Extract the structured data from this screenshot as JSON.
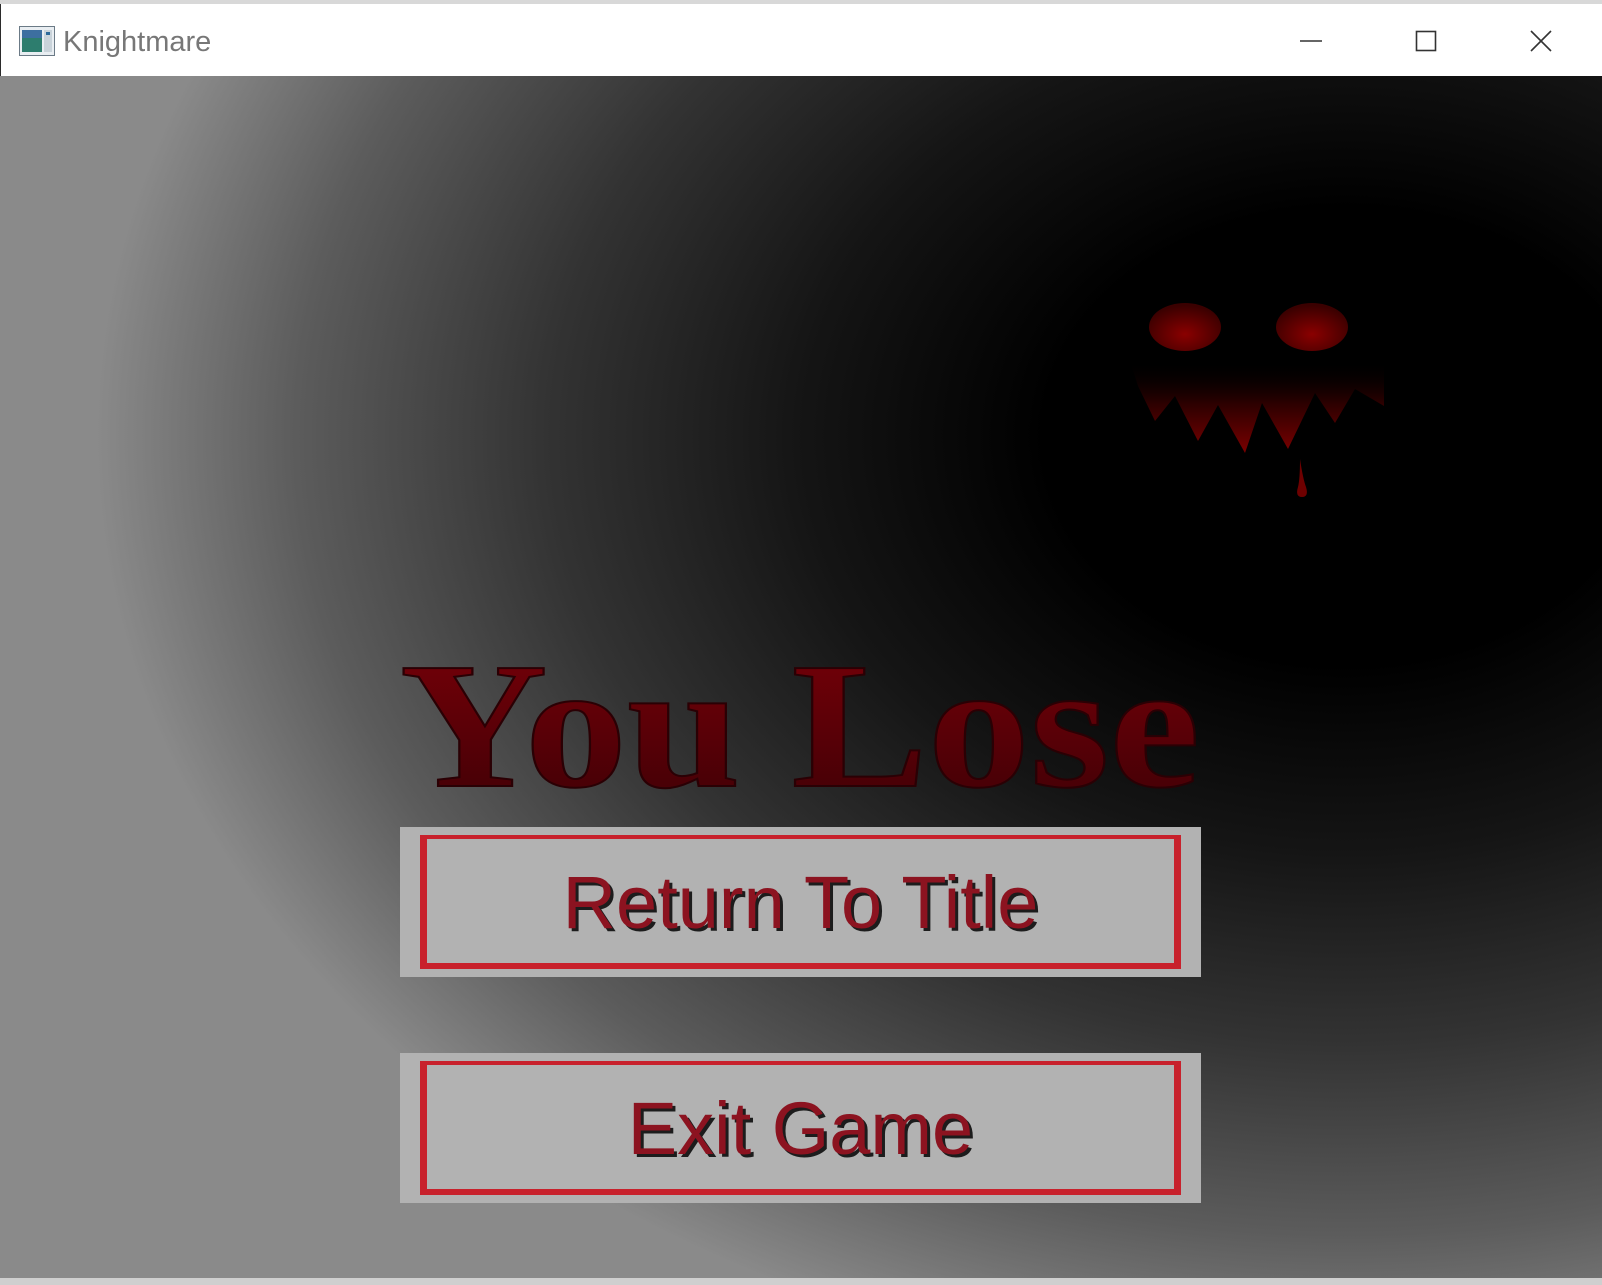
{
  "window": {
    "title": "Knightmare",
    "icon": "app-window-icon",
    "controls": {
      "minimize_icon": "minimize-icon",
      "maximize_icon": "maximize-icon",
      "close_icon": "close-icon"
    }
  },
  "game": {
    "heading": "You Lose",
    "buttons": {
      "return_label": "Return To Title",
      "exit_label": "Exit Game"
    },
    "colors": {
      "heading_red": "#6a0008",
      "button_face": "#b2b2b2",
      "button_border": "#c8212c",
      "button_text": "#8c1320"
    },
    "decoration": "demon-face-icon"
  }
}
